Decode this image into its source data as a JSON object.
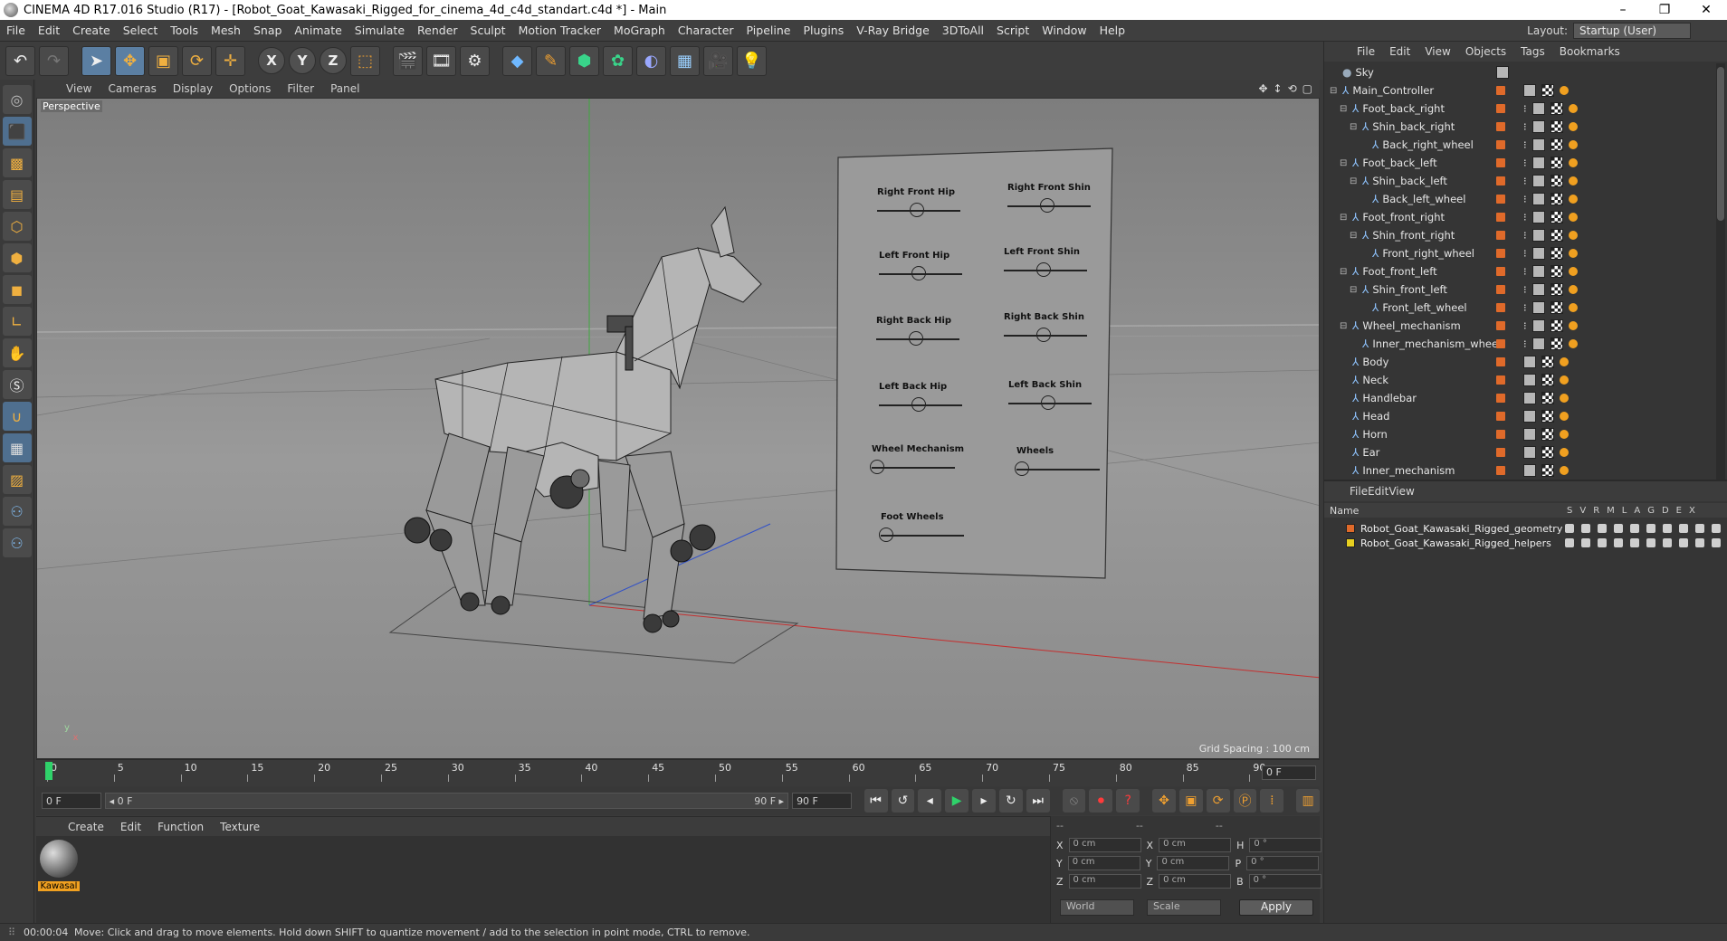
{
  "window": {
    "title": "CINEMA 4D R17.016 Studio (R17) - [Robot_Goat_Kawasaki_Rigged_for_cinema_4d_c4d_standart.c4d *] - Main",
    "minimize": "–",
    "restore": "❐",
    "close": "✕"
  },
  "menu": [
    "File",
    "Edit",
    "Create",
    "Select",
    "Tools",
    "Mesh",
    "Snap",
    "Animate",
    "Simulate",
    "Render",
    "Sculpt",
    "Motion Tracker",
    "MoGraph",
    "Character",
    "Pipeline",
    "Plugins",
    "V-Ray Bridge",
    "3DToAll",
    "Script",
    "Window",
    "Help"
  ],
  "layout": {
    "label": "Layout:",
    "value": "Startup (User)"
  },
  "viewport": {
    "menu": [
      "View",
      "Cameras",
      "Display",
      "Options",
      "Filter",
      "Panel"
    ],
    "label": "Perspective",
    "grid_spacing": "Grid Spacing : 100 cm",
    "board_labels": [
      "Right Front Hip",
      "Right Front Shin",
      "Left Front Hip",
      "Left Front Shin",
      "Right Back Hip",
      "Right Back Shin",
      "Left Back Hip",
      "Left Back Shin",
      "Wheel Mechanism",
      "Wheels",
      "Foot Wheels"
    ]
  },
  "timeline": {
    "ticks": [
      "0",
      "5",
      "10",
      "15",
      "20",
      "25",
      "30",
      "35",
      "40",
      "45",
      "50",
      "55",
      "60",
      "65",
      "70",
      "75",
      "80",
      "85",
      "90"
    ],
    "current_frame": "0 F"
  },
  "transport": {
    "start": "0 F",
    "range_start": "◂ 0 F",
    "range_end": "90 F ▸",
    "end": "90 F"
  },
  "material_manager": {
    "menu": [
      "Create",
      "Edit",
      "Function",
      "Texture"
    ],
    "material_name": "Kawasal"
  },
  "coordinates": {
    "header": [
      "--",
      "--",
      "--"
    ],
    "rows": [
      {
        "a": "X",
        "av": "0 cm",
        "b": "X",
        "bv": "0 cm",
        "c": "H",
        "cv": "0 °"
      },
      {
        "a": "Y",
        "av": "0 cm",
        "b": "Y",
        "bv": "0 cm",
        "c": "P",
        "cv": "0 °"
      },
      {
        "a": "Z",
        "av": "0 cm",
        "b": "Z",
        "bv": "0 cm",
        "c": "B",
        "cv": "0 °"
      }
    ],
    "space": "World",
    "mode": "Scale",
    "apply": "Apply"
  },
  "object_manager": {
    "menu": [
      "File",
      "Edit",
      "View",
      "Objects",
      "Tags",
      "Bookmarks"
    ],
    "objects": [
      {
        "name": "Sky",
        "depth": 0,
        "expand": ""
      },
      {
        "name": "Main_Controller",
        "depth": 0,
        "expand": "⊟"
      },
      {
        "name": "Foot_back_right",
        "depth": 1,
        "expand": "⊟"
      },
      {
        "name": "Shin_back_right",
        "depth": 2,
        "expand": "⊟"
      },
      {
        "name": "Back_right_wheel",
        "depth": 3,
        "expand": ""
      },
      {
        "name": "Foot_back_left",
        "depth": 1,
        "expand": "⊟"
      },
      {
        "name": "Shin_back_left",
        "depth": 2,
        "expand": "⊟"
      },
      {
        "name": "Back_left_wheel",
        "depth": 3,
        "expand": ""
      },
      {
        "name": "Foot_front_right",
        "depth": 1,
        "expand": "⊟"
      },
      {
        "name": "Shin_front_right",
        "depth": 2,
        "expand": "⊟"
      },
      {
        "name": "Front_right_wheel",
        "depth": 3,
        "expand": ""
      },
      {
        "name": "Foot_front_left",
        "depth": 1,
        "expand": "⊟"
      },
      {
        "name": "Shin_front_left",
        "depth": 2,
        "expand": "⊟"
      },
      {
        "name": "Front_left_wheel",
        "depth": 3,
        "expand": ""
      },
      {
        "name": "Wheel_mechanism",
        "depth": 1,
        "expand": "⊟"
      },
      {
        "name": "Inner_mechanism_wheel",
        "depth": 2,
        "expand": ""
      },
      {
        "name": "Body",
        "depth": 1,
        "expand": ""
      },
      {
        "name": "Neck",
        "depth": 1,
        "expand": ""
      },
      {
        "name": "Handlebar",
        "depth": 1,
        "expand": ""
      },
      {
        "name": "Head",
        "depth": 1,
        "expand": ""
      },
      {
        "name": "Horn",
        "depth": 1,
        "expand": ""
      },
      {
        "name": "Ear",
        "depth": 1,
        "expand": ""
      },
      {
        "name": "Inner_mechanism",
        "depth": 1,
        "expand": ""
      }
    ]
  },
  "layer_manager": {
    "menu": [
      "File",
      "Edit",
      "View"
    ],
    "name_header": "Name",
    "columns": [
      "S",
      "V",
      "R",
      "M",
      "L",
      "A",
      "G",
      "D",
      "E",
      "X"
    ],
    "layers": [
      {
        "name": "Robot_Goat_Kawasaki_Rigged_geometry",
        "color": "#e06a2a"
      },
      {
        "name": "Robot_Goat_Kawasaki_Rigged_helpers",
        "color": "#e8d020"
      }
    ]
  },
  "status": {
    "time": "00:00:04",
    "message": "Move: Click and drag to move elements. Hold down SHIFT to quantize movement / add to the selection in point mode, CTRL to remove."
  }
}
